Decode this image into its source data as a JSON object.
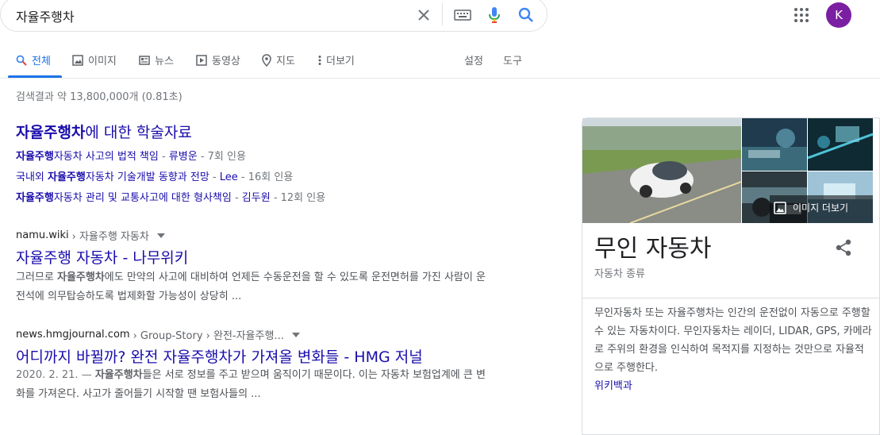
{
  "search": {
    "query": "자율주행차"
  },
  "account": {
    "avatar_letter": "K"
  },
  "tabs": [
    {
      "label": "전체"
    },
    {
      "label": "이미지"
    },
    {
      "label": "뉴스"
    },
    {
      "label": "동영상"
    },
    {
      "label": "지도"
    },
    {
      "label": "더보기"
    }
  ],
  "tools": {
    "settings": "설정",
    "tools": "도구"
  },
  "stats": "검색결과 약 13,800,000개 (0.81초)",
  "scholar": {
    "title_bold": "자율주행차",
    "title_rest": "에 대한 학술자료",
    "items": [
      {
        "pre": "",
        "bold": "자율주행",
        "rest": "자동차 사고의 법적 책임",
        "sep": " - ",
        "author": "류병운",
        "cite": " - 7회 인용"
      },
      {
        "pre": "국내외 ",
        "bold": "자율주행",
        "rest": "자동차 기술개발 동향과 전망",
        "sep": " - ",
        "author": "Lee",
        "cite": " - 16회 인용"
      },
      {
        "pre": "",
        "bold": "자율주행",
        "rest": "자동차 관리 및 교통사고에 대한 형사책임",
        "sep": " - ",
        "author": "김두원",
        "cite": " - 12회 인용"
      }
    ]
  },
  "results": [
    {
      "site": "namu.wiki",
      "path": " › 자율주행 자동차",
      "title": "자율주행 자동차 - 나무위키",
      "snippet_pre": "그러므로 ",
      "snippet_bold": "자율주행차",
      "snippet_rest": "에도 만약의 사고에 대비하여 언제든 수동운전을 할 수 있도록 운전면허를 가진 사람이 운전석에 의무탑승하도록 법제화할 가능성이 상당히 ..."
    },
    {
      "site": "news.hmgjournal.com",
      "path": " › Group-Story › 완전-자율주행...",
      "title": "어디까지 바뀔까? 완전 자율주행차가 가져올 변화들 - HMG 저널",
      "date": "2020. 2. 21. — ",
      "snippet_bold": "자율주행차",
      "snippet_rest": "들은 서로 정보를 주고 받으며 움직이기 때문이다. 이는 자동차 보험업계에 큰 변화를 가져온다. 사고가 줄어들기 시작할 땐 보험사들의 ..."
    }
  ],
  "knowledge_panel": {
    "title": "무인 자동차",
    "subtitle": "자동차 종류",
    "more_images": "이미지 더보기",
    "description": "무인자동차 또는 자율주행차는 인간의 운전없이 자동으로 주행할 수 있는 자동차이다. 무인자동차는 레이더, LIDAR, GPS, 카메라로 주위의 환경을 인식하여 목적지를 지정하는 것만으로 자율적으로 주행한다.",
    "source": "위키백과"
  },
  "colors": {
    "link": "#1a0dab",
    "accent": "#1a73e8",
    "avatar": "#7b1fa2"
  }
}
